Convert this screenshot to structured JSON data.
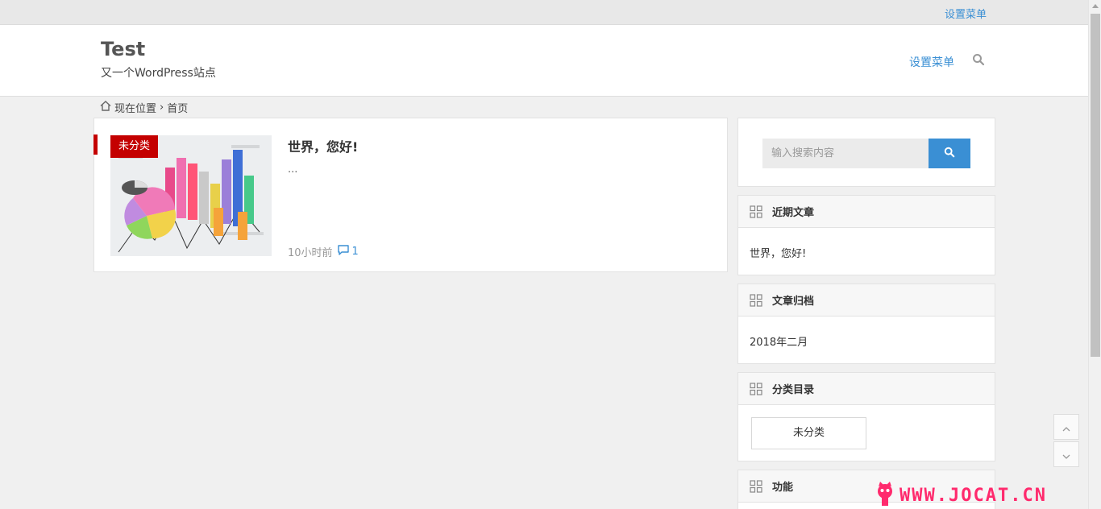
{
  "topbar": {
    "menu_link": "设置菜单"
  },
  "header": {
    "site_title": "Test",
    "site_desc": "又一个WordPress站点",
    "nav_link": "设置菜单"
  },
  "breadcrumb": {
    "current": "现在位置",
    "separator": "›",
    "home": "首页"
  },
  "post": {
    "category": "未分类",
    "title": "世界，您好!",
    "excerpt": "...",
    "time": "10小时前",
    "comments": "1"
  },
  "sidebar": {
    "search_placeholder": "输入搜索内容",
    "recent": {
      "title": "近期文章",
      "items": [
        "世界，您好!"
      ]
    },
    "archive": {
      "title": "文章归档",
      "items": [
        "2018年二月"
      ]
    },
    "categories": {
      "title": "分类目录",
      "items": [
        "未分类"
      ]
    },
    "functions": {
      "title": "功能"
    }
  },
  "watermark": {
    "text": "WWW.JOCAT.CN"
  },
  "colors": {
    "accent": "#3a8fd4",
    "badge": "#c40000",
    "watermark": "#ff2a6d"
  }
}
